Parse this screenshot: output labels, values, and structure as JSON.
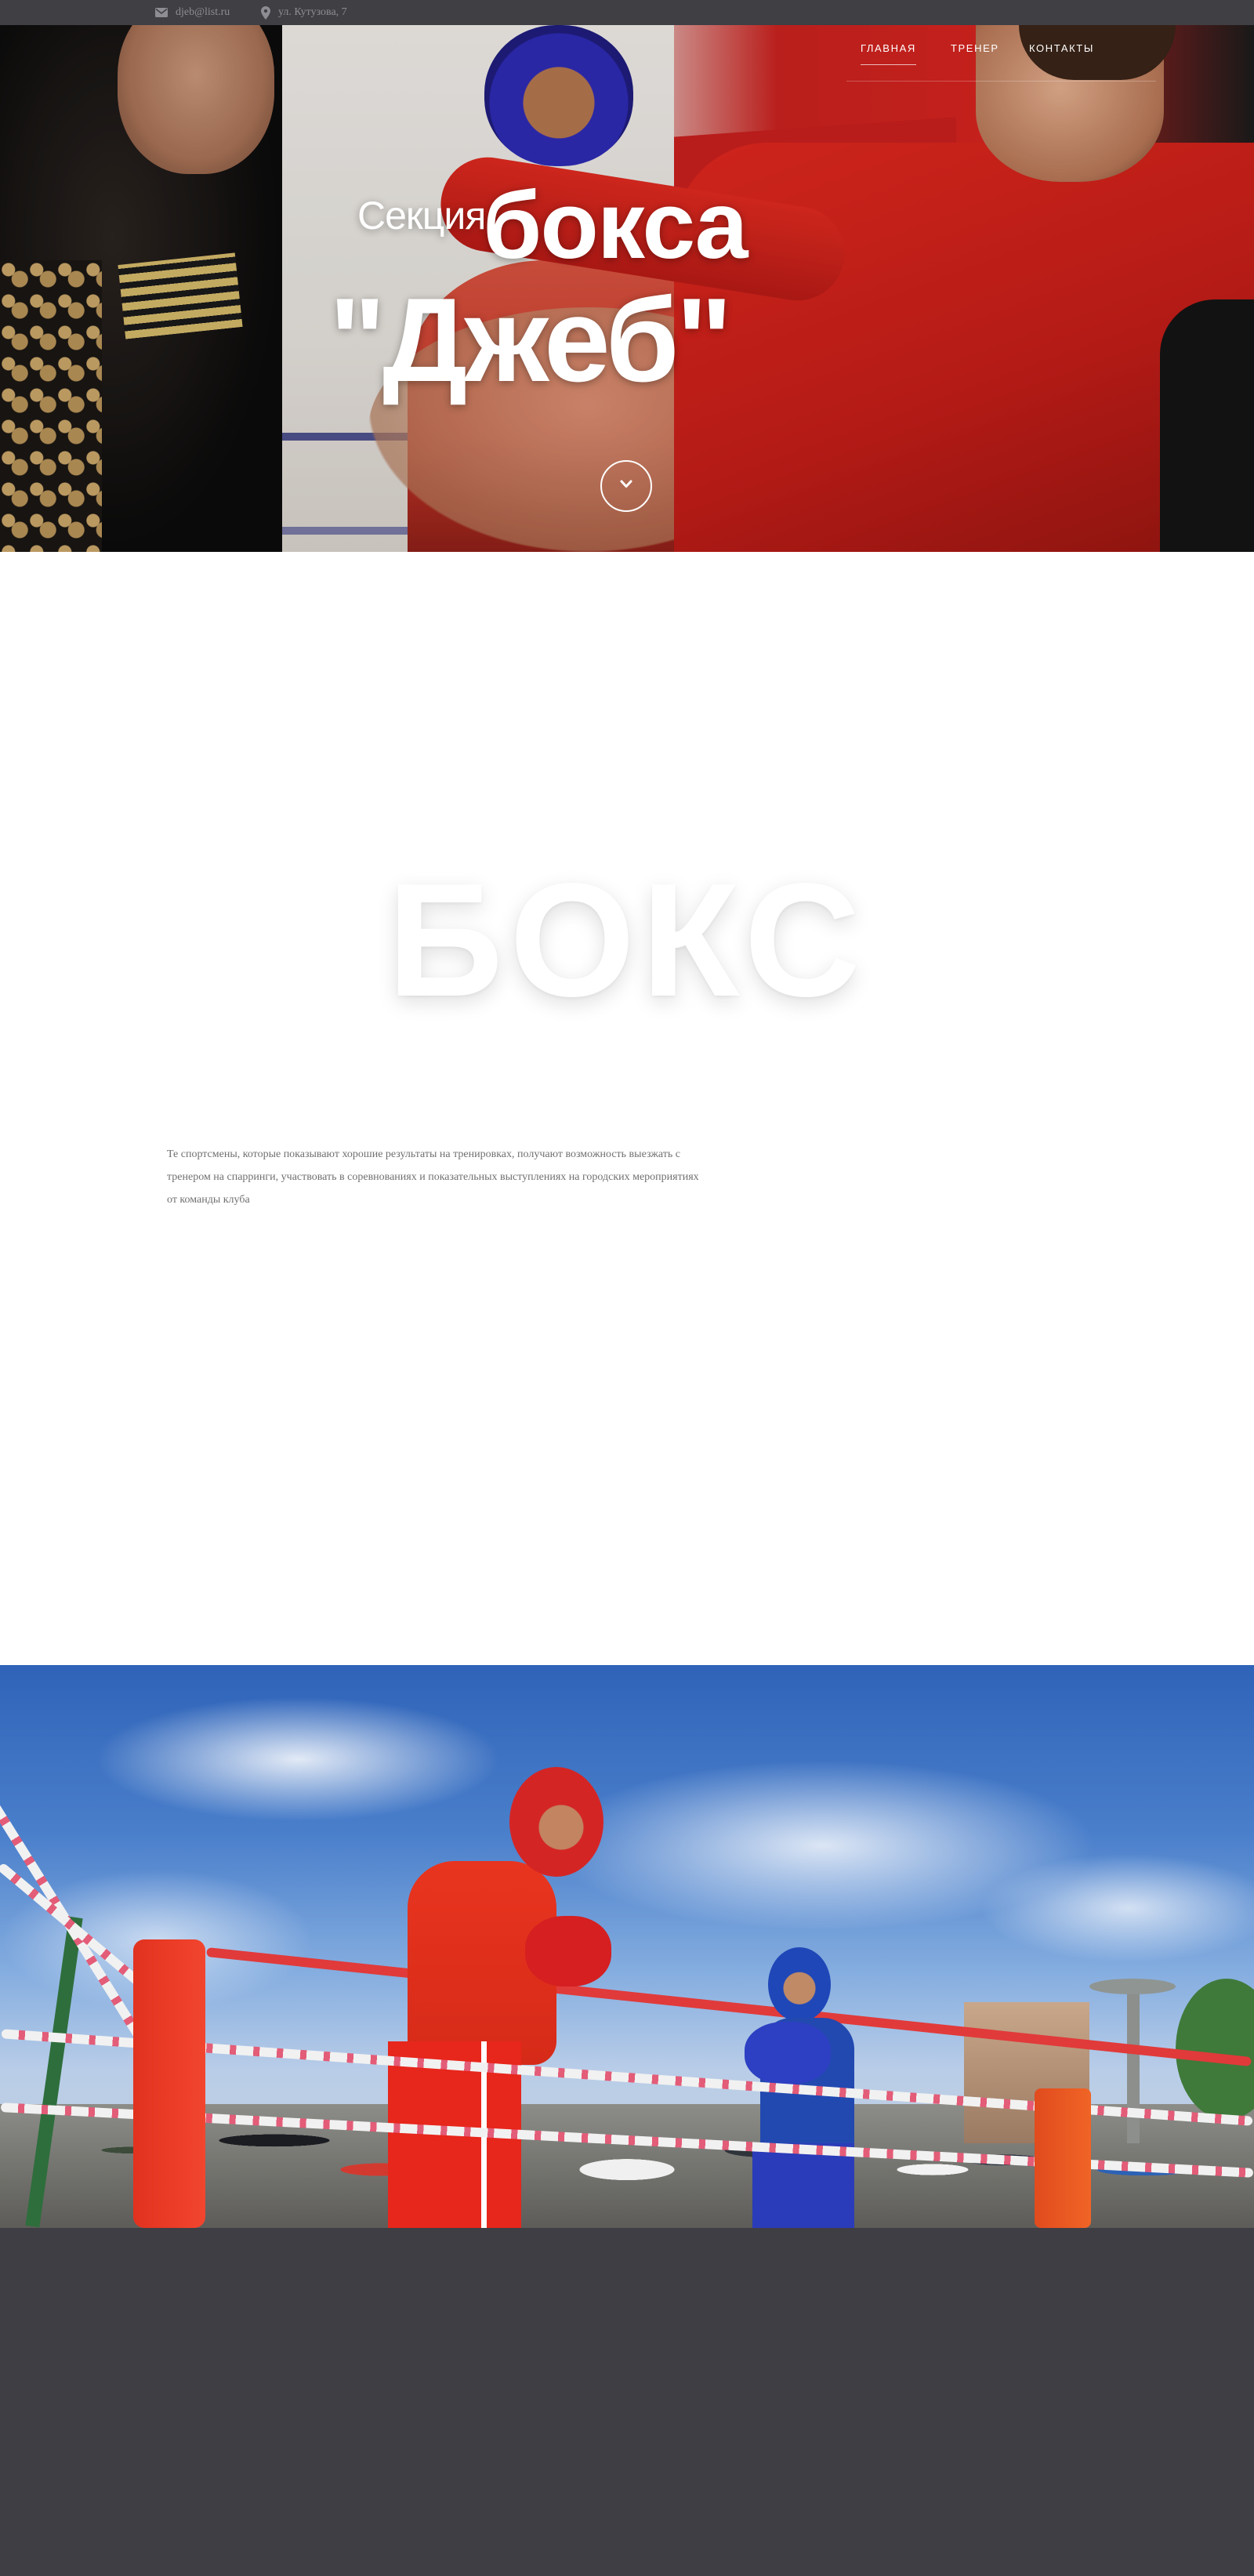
{
  "topbar": {
    "email": "djeb@list.ru",
    "address": "ул. Кутузова, 7",
    "email_icon": "envelope-icon",
    "address_icon": "map-pin-icon"
  },
  "nav": {
    "items": [
      {
        "label": "Главная",
        "active": true
      },
      {
        "label": "Тренер",
        "active": false
      },
      {
        "label": "Контакты",
        "active": false
      }
    ]
  },
  "hero": {
    "title_small": "Секция",
    "title_big": "бокса",
    "title_name": "\"Джеб\"",
    "scroll_icon": "chevron-down-icon"
  },
  "about": {
    "watermark": "БОКС",
    "text": "Те спортсмены, которые показывают хорошие результаты на тренировках, получают возможность выезжать с тренером на спарринги, участвовать в соревнованиях и показательных выступлениях на городских мероприятиях от команды клуба"
  },
  "colors": {
    "topbar_bg": "#3f3f44",
    "footer_bg": "#3f3e44",
    "text_muted": "#707070",
    "white": "#ffffff"
  }
}
